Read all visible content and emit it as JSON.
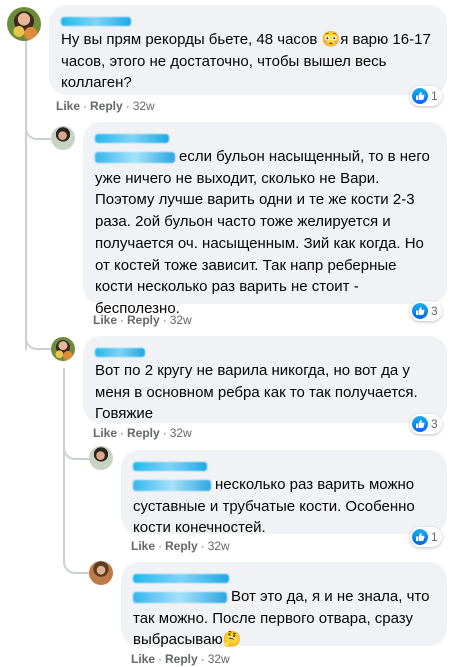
{
  "comments": [
    {
      "text": "Ну вы прям рекорды бьете, 48 часов 😳я варю 16-17 часов, этого не достаточно, чтобы вышел весь коллаген?",
      "like_label": "Like",
      "reply_label": "Reply",
      "time": "32w",
      "reactions": "1"
    },
    {
      "text": "если бульон насыщенный, то в него уже ничего не выходит, сколько не Вари. Поэтому лучше варить одни и те же кости 2-3 раза. 2ой бульон часто тоже желируется и получается оч. насыщенным. Зий как когда. Но от костей тоже зависит. Так напр реберные кости несколько раз варить не стоит - бесполезно.",
      "like_label": "Like",
      "reply_label": "Reply",
      "time": "32w",
      "reactions": "3"
    },
    {
      "text": "Вот по 2 кругу не варила никогда, но вот да у меня в основном ребра как то так получается. Говяжие",
      "like_label": "Like",
      "reply_label": "Reply",
      "time": "32w",
      "reactions": "3"
    },
    {
      "text": "несколько раз варить можно суставные и трубчатые кости. Особенно кости конечностей.",
      "like_label": "Like",
      "reply_label": "Reply",
      "time": "32w",
      "reactions": "1"
    },
    {
      "text": "Вот это да, я и не знала, что так можно. После первого отвара, сразу выбрасываю🤔",
      "like_label": "Like",
      "reply_label": "Reply",
      "time": "32w"
    }
  ],
  "colors": {
    "bubble": "#f0f2f5",
    "meta_text": "#65676b",
    "like_blue": "#1877f2",
    "redaction": "#1fb8ee"
  },
  "icons": {
    "reaction": "like-thumb-icon"
  }
}
